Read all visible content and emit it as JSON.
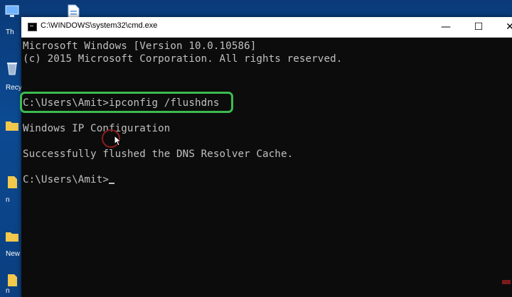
{
  "window": {
    "title": "C:\\WINDOWS\\system32\\cmd.exe",
    "minimize_glyph": "—",
    "maximize_glyph": "☐",
    "close_glyph": "✕"
  },
  "desktop": {
    "labels": [
      "Th",
      "Recy",
      "n",
      "New",
      "n"
    ]
  },
  "console": {
    "lines": [
      "Microsoft Windows [Version 10.0.10586]",
      "(c) 2015 Microsoft Corporation. All rights reserved.",
      "",
      "C:\\Users\\Amit>ipconfig /flushdns",
      "",
      "Windows IP Configuration",
      "",
      "Successfully flushed the DNS Resolver Cache.",
      "",
      "C:\\Users\\Amit>"
    ]
  },
  "colors": {
    "console_bg": "#0c0c0c",
    "console_text": "#c0c0c0",
    "highlight": "#3dbb4f",
    "click_ring": "#8a1d1d"
  },
  "icons": {
    "title": "cmd-icon",
    "cursor": "mouse-pointer-icon"
  }
}
